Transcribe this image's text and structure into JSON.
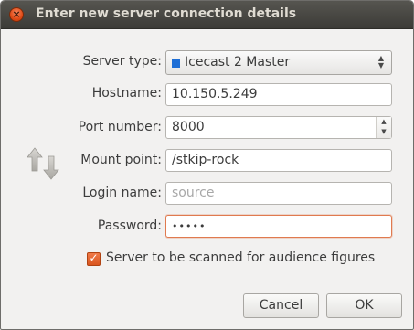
{
  "window": {
    "title": "Enter new server connection details",
    "close_symbol": "×"
  },
  "form": {
    "server_type": {
      "label": "Server type:",
      "value": "Icecast 2 Master",
      "icon": "blue-square-icon",
      "icon_color": "#1f6fd6"
    },
    "hostname": {
      "label": "Hostname:",
      "value": "10.150.5.249"
    },
    "port": {
      "label": "Port number:",
      "value": "8000"
    },
    "mount": {
      "label": "Mount point:",
      "value": "/stkip-rock"
    },
    "login": {
      "label": "Login name:",
      "placeholder": "source"
    },
    "password": {
      "label": "Password:",
      "value": "•••••"
    },
    "scan": {
      "label": "Server to be scanned for audience figures",
      "checked": true
    }
  },
  "buttons": {
    "cancel": "Cancel",
    "ok": "OK"
  },
  "side_icon": "transfer-arrows-icon",
  "colors": {
    "titlebar": "#3c3b37",
    "accent": "#df4a16",
    "focus_border": "#e07a4f"
  }
}
